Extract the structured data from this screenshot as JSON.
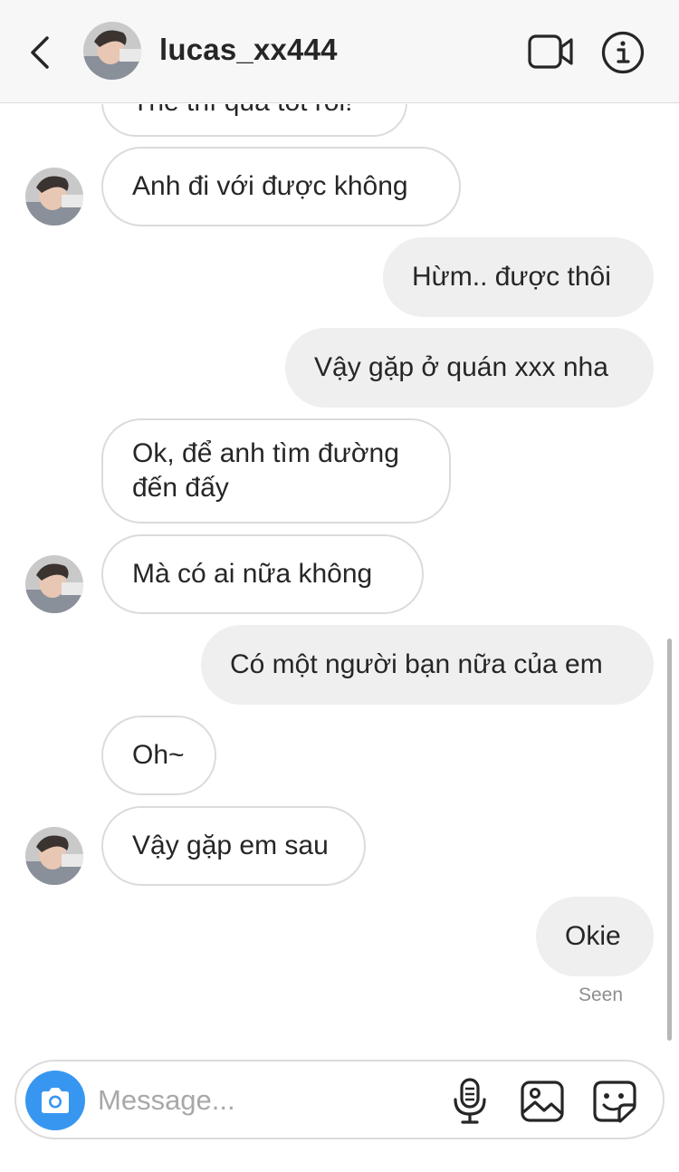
{
  "header": {
    "username": "lucas_xx444",
    "back_icon": "chevron-left-icon",
    "video_icon": "video-camera-icon",
    "info_icon": "info-icon"
  },
  "messages": [
    {
      "side": "in",
      "text": "Thế thì quá tốt rồi!",
      "partial": true
    },
    {
      "side": "in",
      "text": "Anh đi với được không",
      "avatar": true
    },
    {
      "side": "out",
      "text": "Hừm.. được thôi"
    },
    {
      "side": "out",
      "text": "Vậy gặp ở quán xxx nha"
    },
    {
      "side": "in",
      "text": "Ok, để anh tìm đường đến đấy"
    },
    {
      "side": "in",
      "text": "Mà có ai nữa không",
      "avatar": true
    },
    {
      "side": "out",
      "text": "Có một người bạn nữa của em"
    },
    {
      "side": "in",
      "text": "Oh~"
    },
    {
      "side": "in",
      "text": "Vậy gặp em sau",
      "avatar": true
    },
    {
      "side": "out",
      "text": "Okie"
    }
  ],
  "seen_label": "Seen",
  "composer": {
    "placeholder": "Message...",
    "camera_icon": "camera-icon",
    "mic_icon": "microphone-icon",
    "gallery_icon": "image-gallery-icon",
    "sticker_icon": "sticker-icon"
  },
  "colors": {
    "accent": "#3797f0",
    "outgoing_bubble": "#efefef",
    "incoming_border": "#dbdbdb",
    "header_bg": "#f7f7f7"
  }
}
